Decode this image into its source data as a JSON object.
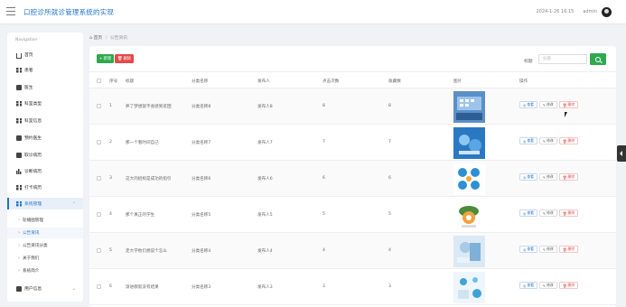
{
  "header": {
    "title": "口腔诊所就诊管理系统的实现",
    "datetime": "2024-1-26 16:15",
    "user": "admin"
  },
  "sidebar": {
    "heading": "Navigation",
    "items": [
      {
        "label": "首页",
        "icon": "home-icon"
      },
      {
        "label": "患者",
        "icon": "grid-icon"
      },
      {
        "label": "医生",
        "icon": "grid-icon"
      },
      {
        "label": "科室类型",
        "icon": "grid-icon"
      },
      {
        "label": "科室信息",
        "icon": "grid-icon"
      },
      {
        "label": "预约医生",
        "icon": "box-icon"
      },
      {
        "label": "取诊病历",
        "icon": "box-icon"
      },
      {
        "label": "诊断病历",
        "icon": "bars-icon"
      },
      {
        "label": "打卡病历",
        "icon": "grid-icon"
      },
      {
        "label": "系统管理",
        "icon": "grid-icon",
        "expanded": true
      }
    ],
    "subitems": [
      {
        "label": "轮播图管理"
      },
      {
        "label": "公告资讯"
      },
      {
        "label": "公告资讯分类"
      },
      {
        "label": "关于我们"
      },
      {
        "label": "系统简介"
      }
    ],
    "last_item": {
      "label": "用户信息",
      "icon": "box-icon"
    }
  },
  "breadcrumb": {
    "home": "首页",
    "separator": "/",
    "current": "公告资讯"
  },
  "toolbar": {
    "add_label": "新增",
    "delete_label": "删除",
    "filter_label": "标题",
    "filter_placeholder": "标题"
  },
  "table": {
    "headers": [
      "序号",
      "标题",
      "分类名称",
      "发布人",
      "点击次数",
      "收藏数",
      "图片",
      "操作"
    ],
    "rows": [
      {
        "index": "1",
        "title": "养了梦想就不会感到贫困",
        "category": "分类名称8",
        "publisher": "发布人8",
        "clicks": "8",
        "favorites": "8"
      },
      {
        "index": "2",
        "title": "那一个看时间自己",
        "category": "分类名称7",
        "publisher": "发布人7",
        "clicks": "7",
        "favorites": "7"
      },
      {
        "index": "3",
        "title": "这大的招标是成功的指引",
        "category": "分类名称6",
        "publisher": "发布人6",
        "clicks": "6",
        "favorites": "6"
      },
      {
        "index": "4",
        "title": "那个真正的学生",
        "category": "分类名称5",
        "publisher": "发布人5",
        "clicks": "5",
        "favorites": "5"
      },
      {
        "index": "5",
        "title": "走大学他们想说个怎么",
        "category": "分类名称4",
        "publisher": "发布人4",
        "clicks": "4",
        "favorites": "4"
      },
      {
        "index": "6",
        "title": "渐进教就没有结果",
        "category": "分类名称3",
        "publisher": "发布人3",
        "clicks": "3",
        "favorites": "3"
      }
    ],
    "actions": {
      "view": "查看",
      "edit": "修改",
      "delete": "删除"
    }
  },
  "colors": {
    "accent": "#1e73c7",
    "success": "#2fa84f",
    "danger": "#e34a4a"
  }
}
